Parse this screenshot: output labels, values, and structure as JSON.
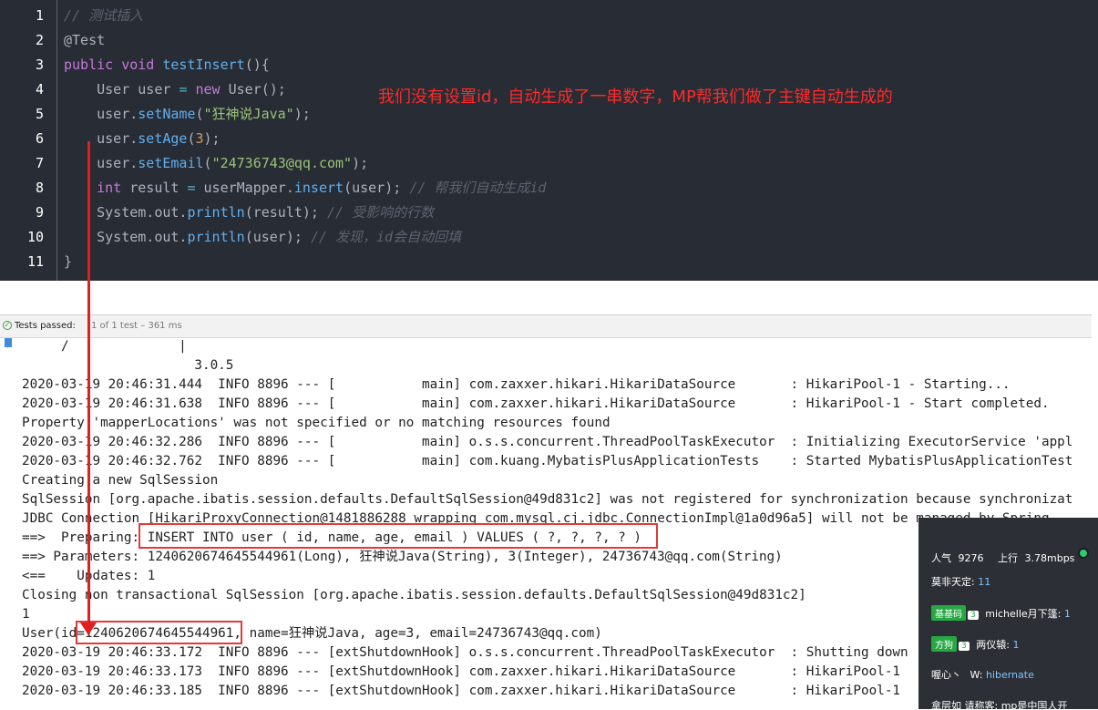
{
  "editor": {
    "lines": [
      {
        "n": "1",
        "parts": [
          [
            "cm",
            "// 测试插入"
          ]
        ]
      },
      {
        "n": "2",
        "parts": [
          [
            "an",
            "@Test"
          ]
        ]
      },
      {
        "n": "3",
        "parts": [
          [
            "kw",
            "public "
          ],
          [
            "kw",
            "void "
          ],
          [
            "fn",
            "testInsert"
          ],
          [
            "pl",
            "(){"
          ]
        ]
      },
      {
        "n": "4",
        "parts": [
          [
            "pl",
            "    User user "
          ],
          [
            "op",
            "= "
          ],
          [
            "kw",
            "new "
          ],
          [
            "pl",
            "User();"
          ]
        ]
      },
      {
        "n": "5",
        "parts": [
          [
            "pl",
            "    user."
          ],
          [
            "fn",
            "setName"
          ],
          [
            "pl",
            "("
          ],
          [
            "str",
            "\"狂神说Java\""
          ],
          [
            "pl",
            ");"
          ]
        ]
      },
      {
        "n": "6",
        "parts": [
          [
            "pl",
            "    user."
          ],
          [
            "fn",
            "setAge"
          ],
          [
            "pl",
            "("
          ],
          [
            "num",
            "3"
          ],
          [
            "pl",
            ");"
          ]
        ]
      },
      {
        "n": "7",
        "parts": [
          [
            "pl",
            "    user."
          ],
          [
            "fn",
            "setEmail"
          ],
          [
            "pl",
            "("
          ],
          [
            "str",
            "\"24736743@qq.com\""
          ],
          [
            "pl",
            ");"
          ]
        ]
      },
      {
        "n": "8",
        "parts": [
          [
            "kw",
            "    int "
          ],
          [
            "pl",
            "result "
          ],
          [
            "op",
            "= "
          ],
          [
            "pl",
            "userMapper."
          ],
          [
            "fn",
            "insert"
          ],
          [
            "pl",
            "(user); "
          ],
          [
            "cm",
            "// 帮我们自动生成id"
          ]
        ]
      },
      {
        "n": "9",
        "parts": [
          [
            "pl",
            "    System.out."
          ],
          [
            "fn",
            "println"
          ],
          [
            "pl",
            "(result); "
          ],
          [
            "cm",
            "// 受影响的行数"
          ]
        ]
      },
      {
        "n": "10",
        "parts": [
          [
            "pl",
            "    System.out."
          ],
          [
            "fn",
            "println"
          ],
          [
            "pl",
            "(user); "
          ],
          [
            "cm",
            "// 发现，id会自动回填"
          ]
        ]
      },
      {
        "n": "11",
        "parts": [
          [
            "pl",
            "}"
          ]
        ]
      }
    ],
    "annotation": "我们没有设置id，自动生成了一串数字，MP帮我们做了主键自动生成的"
  },
  "test_status": {
    "passed_label": "Tests passed:",
    "detail": "1 of 1 test – 361 ms"
  },
  "console_lines": [
    "     /              |",
    "                      3.0.5",
    "2020-03-19 20:46:31.444  INFO 8896 --- [           main] com.zaxxer.hikari.HikariDataSource       : HikariPool-1 - Starting...",
    "2020-03-19 20:46:31.638  INFO 8896 --- [           main] com.zaxxer.hikari.HikariDataSource       : HikariPool-1 - Start completed.",
    "Property 'mapperLocations' was not specified or no matching resources found",
    "2020-03-19 20:46:32.286  INFO 8896 --- [           main] o.s.s.concurrent.ThreadPoolTaskExecutor  : Initializing ExecutorService 'appl",
    "2020-03-19 20:46:32.762  INFO 8896 --- [           main] com.kuang.MybatisPlusApplicationTests    : Started MybatisPlusApplicationTest",
    "Creating a new SqlSession",
    "SqlSession [org.apache.ibatis.session.defaults.DefaultSqlSession@49d831c2] was not registered for synchronization because synchronizat",
    "JDBC Connection [HikariProxyConnection@1481886288 wrapping com.mysql.cj.jdbc.ConnectionImpl@1a0d96a5] will not be managed by Spring",
    "==>  Preparing: INSERT INTO user ( id, name, age, email ) VALUES ( ?, ?, ?, ? )",
    "==> Parameters: 1240620674645544961(Long), 狂神说Java(String), 3(Integer), 24736743@qq.com(String)",
    "<==    Updates: 1",
    "Closing non transactional SqlSession [org.apache.ibatis.session.defaults.DefaultSqlSession@49d831c2]",
    "1",
    "User(id=1240620674645544961, name=狂神说Java, age=3, email=24736743@qq.com)",
    "2020-03-19 20:46:33.172  INFO 8896 --- [extShutdownHook] o.s.s.concurrent.ThreadPoolTaskExecutor  : Shutting down",
    "2020-03-19 20:46:33.173  INFO 8896 --- [extShutdownHook] com.zaxxer.hikari.HikariDataSource       : HikariPool-1",
    "2020-03-19 20:46:33.185  INFO 8896 --- [extShutdownHook] com.zaxxer.hikari.HikariDataSource       : HikariPool-1"
  ],
  "overlay": {
    "popularity_label": "人气",
    "popularity_value": "9276",
    "upload_label": "上行",
    "upload_value": "3.78mbps",
    "row1_name": "莫非天定:",
    "row1_value": "11",
    "row2_tag": "基基码",
    "row2_level": "3",
    "row2_text": "michelle月下篷:",
    "row2_value": "1",
    "row3_tag": "方狗",
    "row3_level": "3",
    "row3_text": "两仪辕:",
    "row3_value": "1",
    "row4_name": "喔心丶",
    "row4_label": "W:",
    "row4_value": "hibernate",
    "row5_text": "拿层如 请称客: mp是中国人开"
  }
}
